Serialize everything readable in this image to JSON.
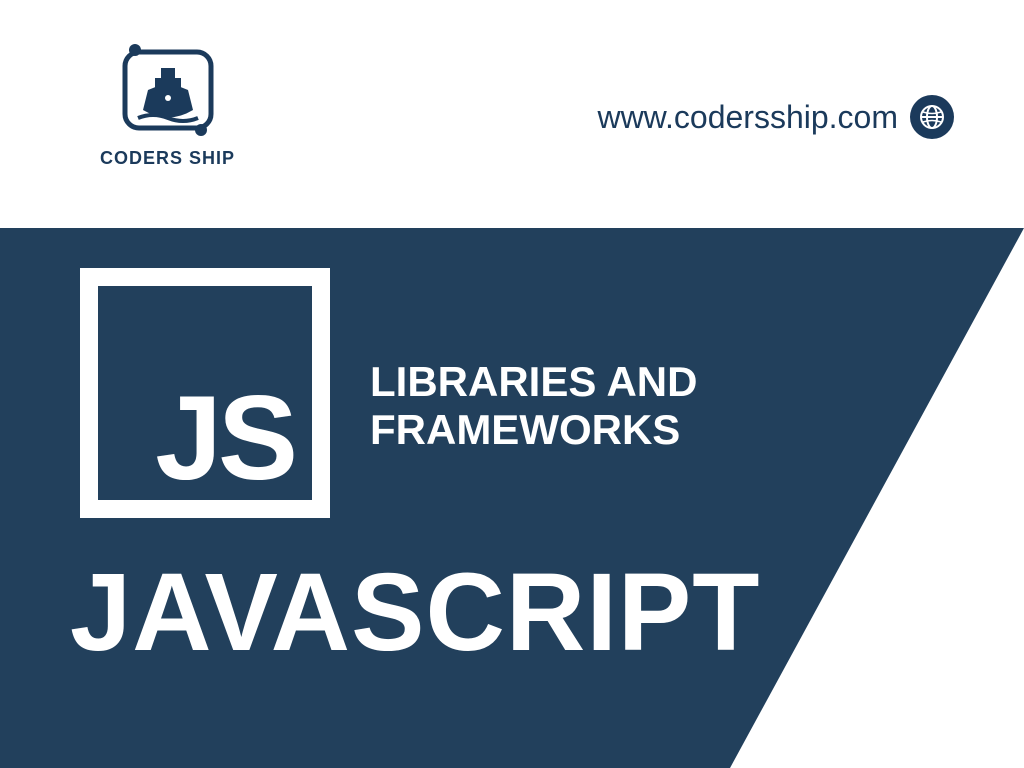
{
  "brand": {
    "name": "CODERS SHIP",
    "url": "www.codersship.com",
    "accent_color": "#1b3a5b",
    "panel_color": "#22405c"
  },
  "hero": {
    "logo_letters": "JS",
    "subtitle_line1": "LIBRARIES AND",
    "subtitle_line2": "FRAMEWORKS",
    "title": "JAVASCRIPT"
  }
}
